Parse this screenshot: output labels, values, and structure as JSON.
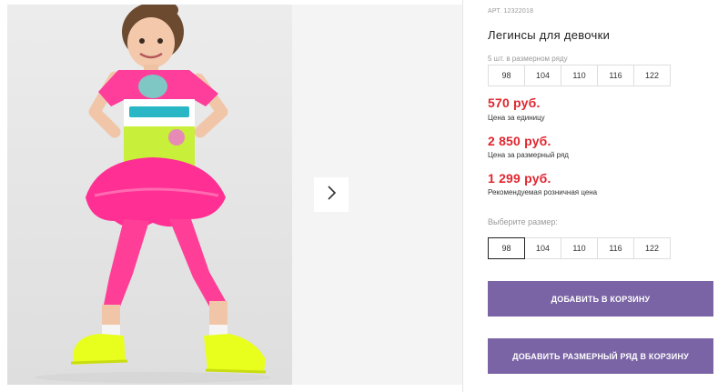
{
  "product": {
    "article": "АРТ. 12322018",
    "title": "Легинсы для девочки"
  },
  "pack": {
    "label": "5 шт. в размерном ряду",
    "sizes": [
      "98",
      "104",
      "110",
      "116",
      "122"
    ]
  },
  "prices": [
    {
      "value": "570 руб.",
      "note": "Цена за единицу"
    },
    {
      "value": "2 850 руб.",
      "note": "Цена за размерный ряд"
    },
    {
      "value": "1 299 руб.",
      "note": "Рекомендуемая розничная цена"
    }
  ],
  "size_select": {
    "label": "Выберите размер:",
    "sizes": [
      "98",
      "104",
      "110",
      "116",
      "122"
    ],
    "selected": "98"
  },
  "buttons": {
    "add_to_cart": "ДОБАВИТЬ В КОРЗИНУ",
    "add_pack_to_cart": "ДОБАВИТЬ РАЗМЕРНЫЙ РЯД В КОРЗИНУ"
  },
  "icons": {
    "next": "chevron-right-icon"
  },
  "colors": {
    "price": "#e1262f",
    "button": "#7a64a5",
    "tshirt": "#ff3d9a",
    "tutu": "#ff2f93",
    "sneakers": "#e8ff1e"
  }
}
